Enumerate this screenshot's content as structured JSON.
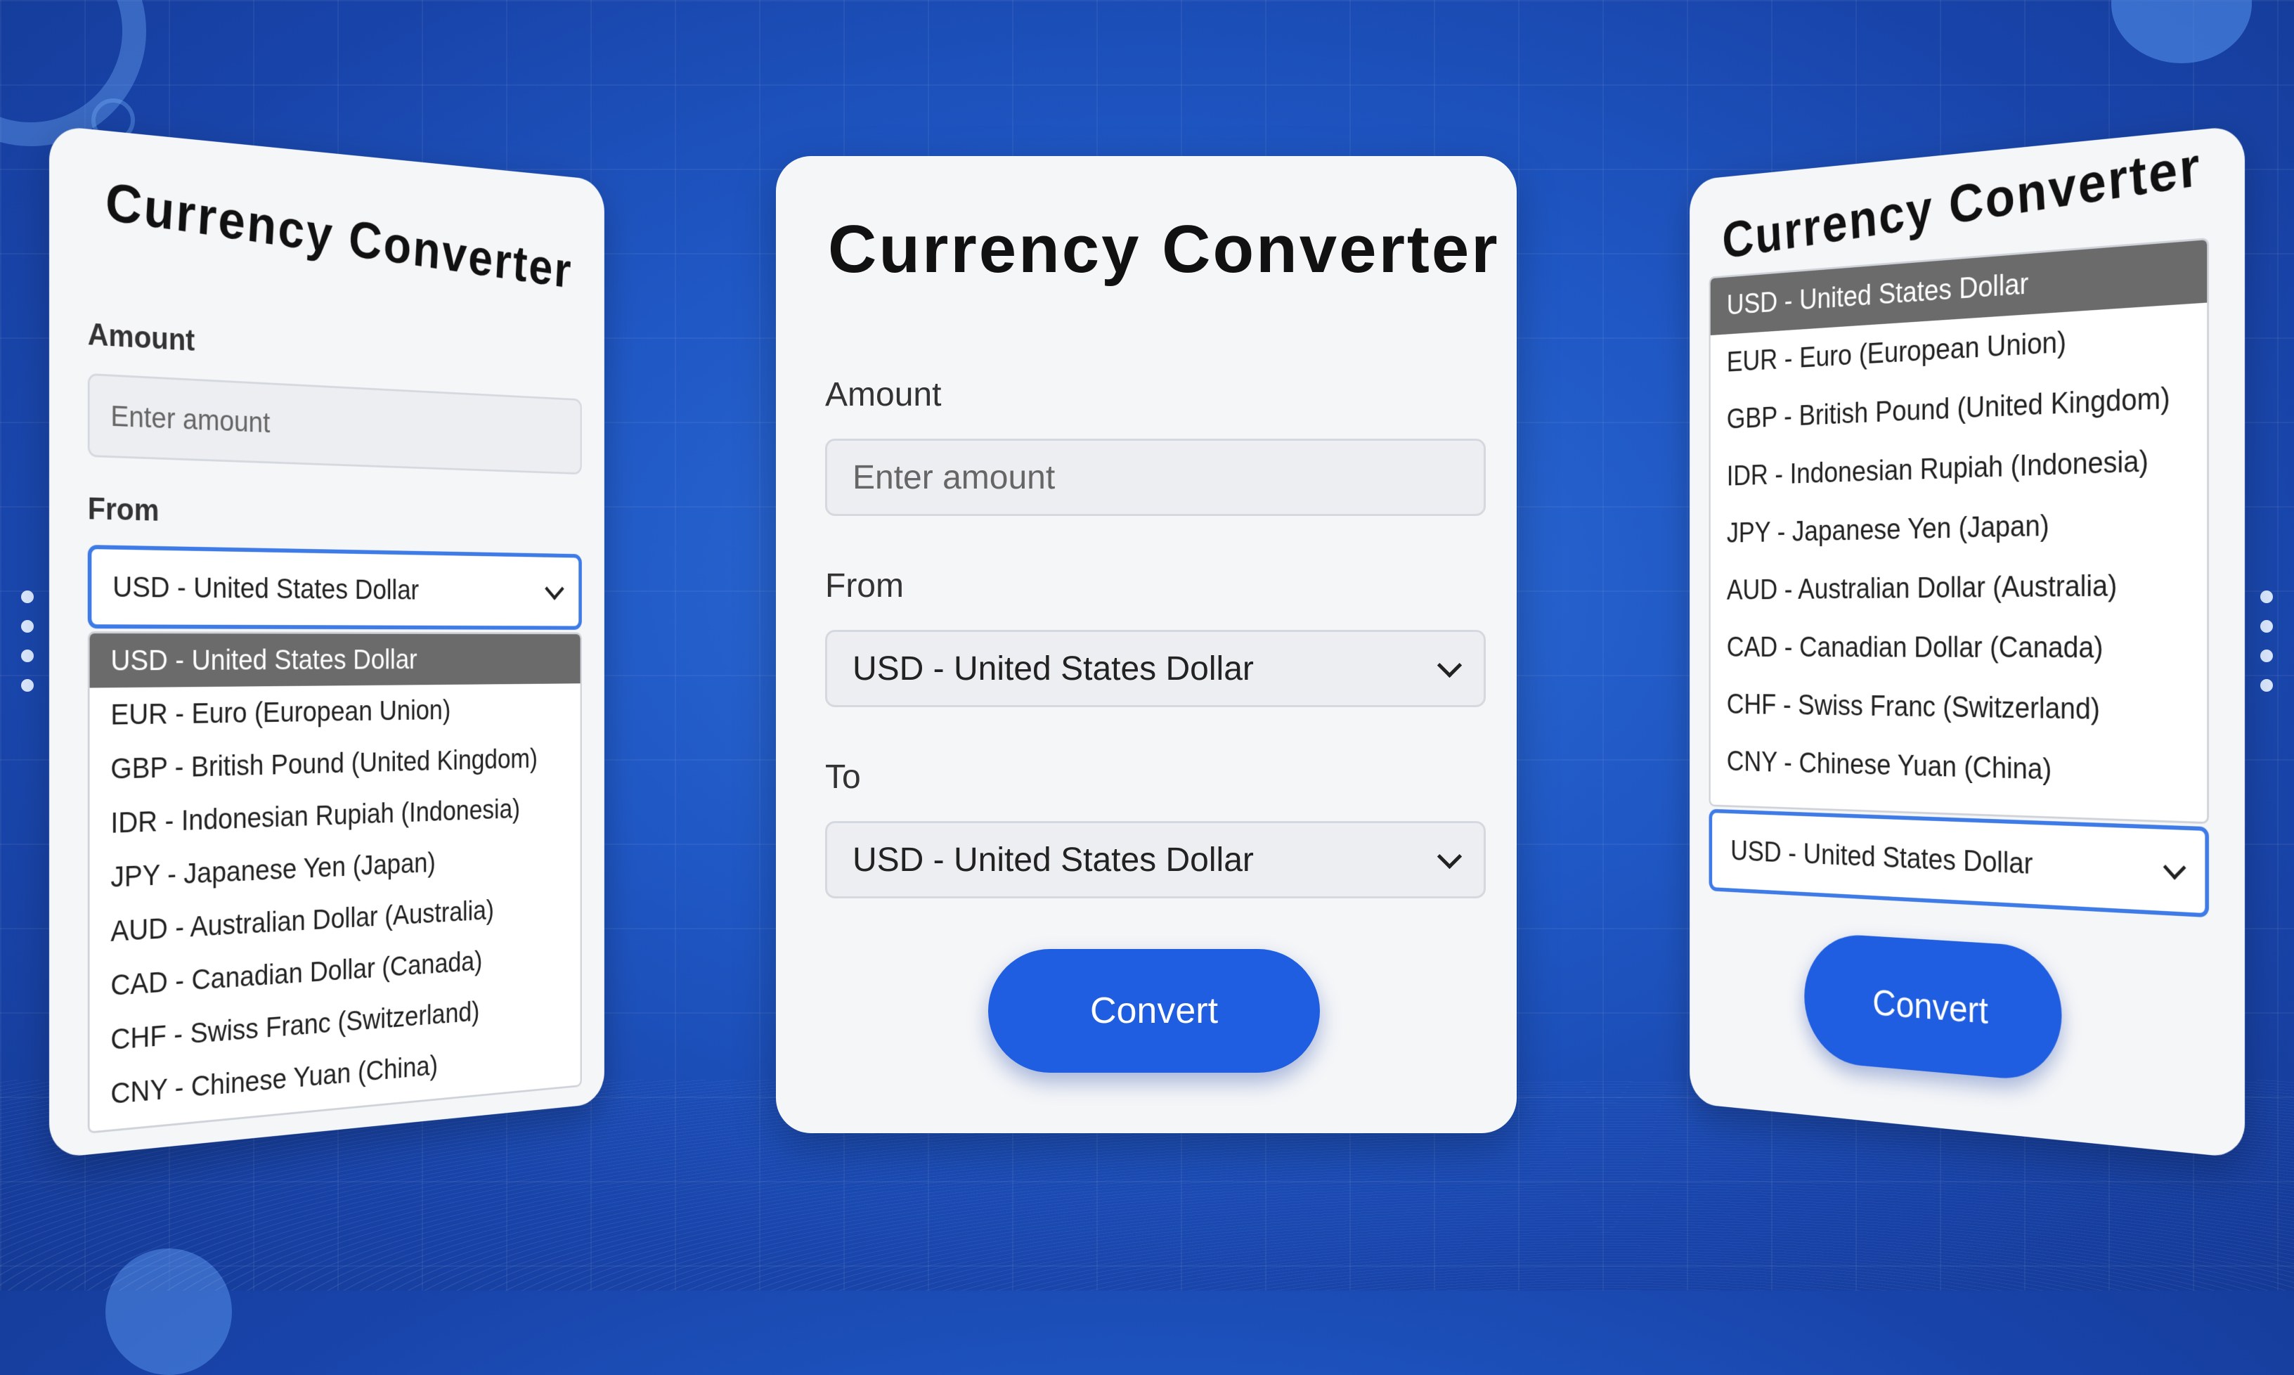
{
  "cards": {
    "left": {
      "title": "Currency Converter",
      "amount_label": "Amount",
      "amount_placeholder": "Enter amount",
      "from_label": "From",
      "from_value": "USD - United States Dollar"
    },
    "center": {
      "title": "Currency Converter",
      "amount_label": "Amount",
      "amount_placeholder": "Enter amount",
      "from_label": "From",
      "from_value": "USD - United States Dollar",
      "to_label": "To",
      "to_value": "USD - United States Dollar",
      "convert_label": "Convert"
    },
    "right": {
      "title": "Currency Converter",
      "select_value": "USD - United States Dollar",
      "convert_label": "Convert"
    }
  },
  "currency_options": [
    "USD - United States Dollar",
    "EUR - Euro (European Union)",
    "GBP - British Pound (United Kingdom)",
    "IDR - Indonesian Rupiah (Indonesia)",
    "JPY - Japanese Yen (Japan)",
    "AUD - Australian Dollar (Australia)",
    "CAD - Canadian Dollar (Canada)",
    "CHF - Swiss Franc (Switzerland)",
    "CNY - Chinese Yuan (China)"
  ],
  "colors": {
    "accent": "#1f5ee0",
    "focus_border": "#3f7be6",
    "selected_option": "#6b6b6b",
    "background": "#1f57c4"
  }
}
